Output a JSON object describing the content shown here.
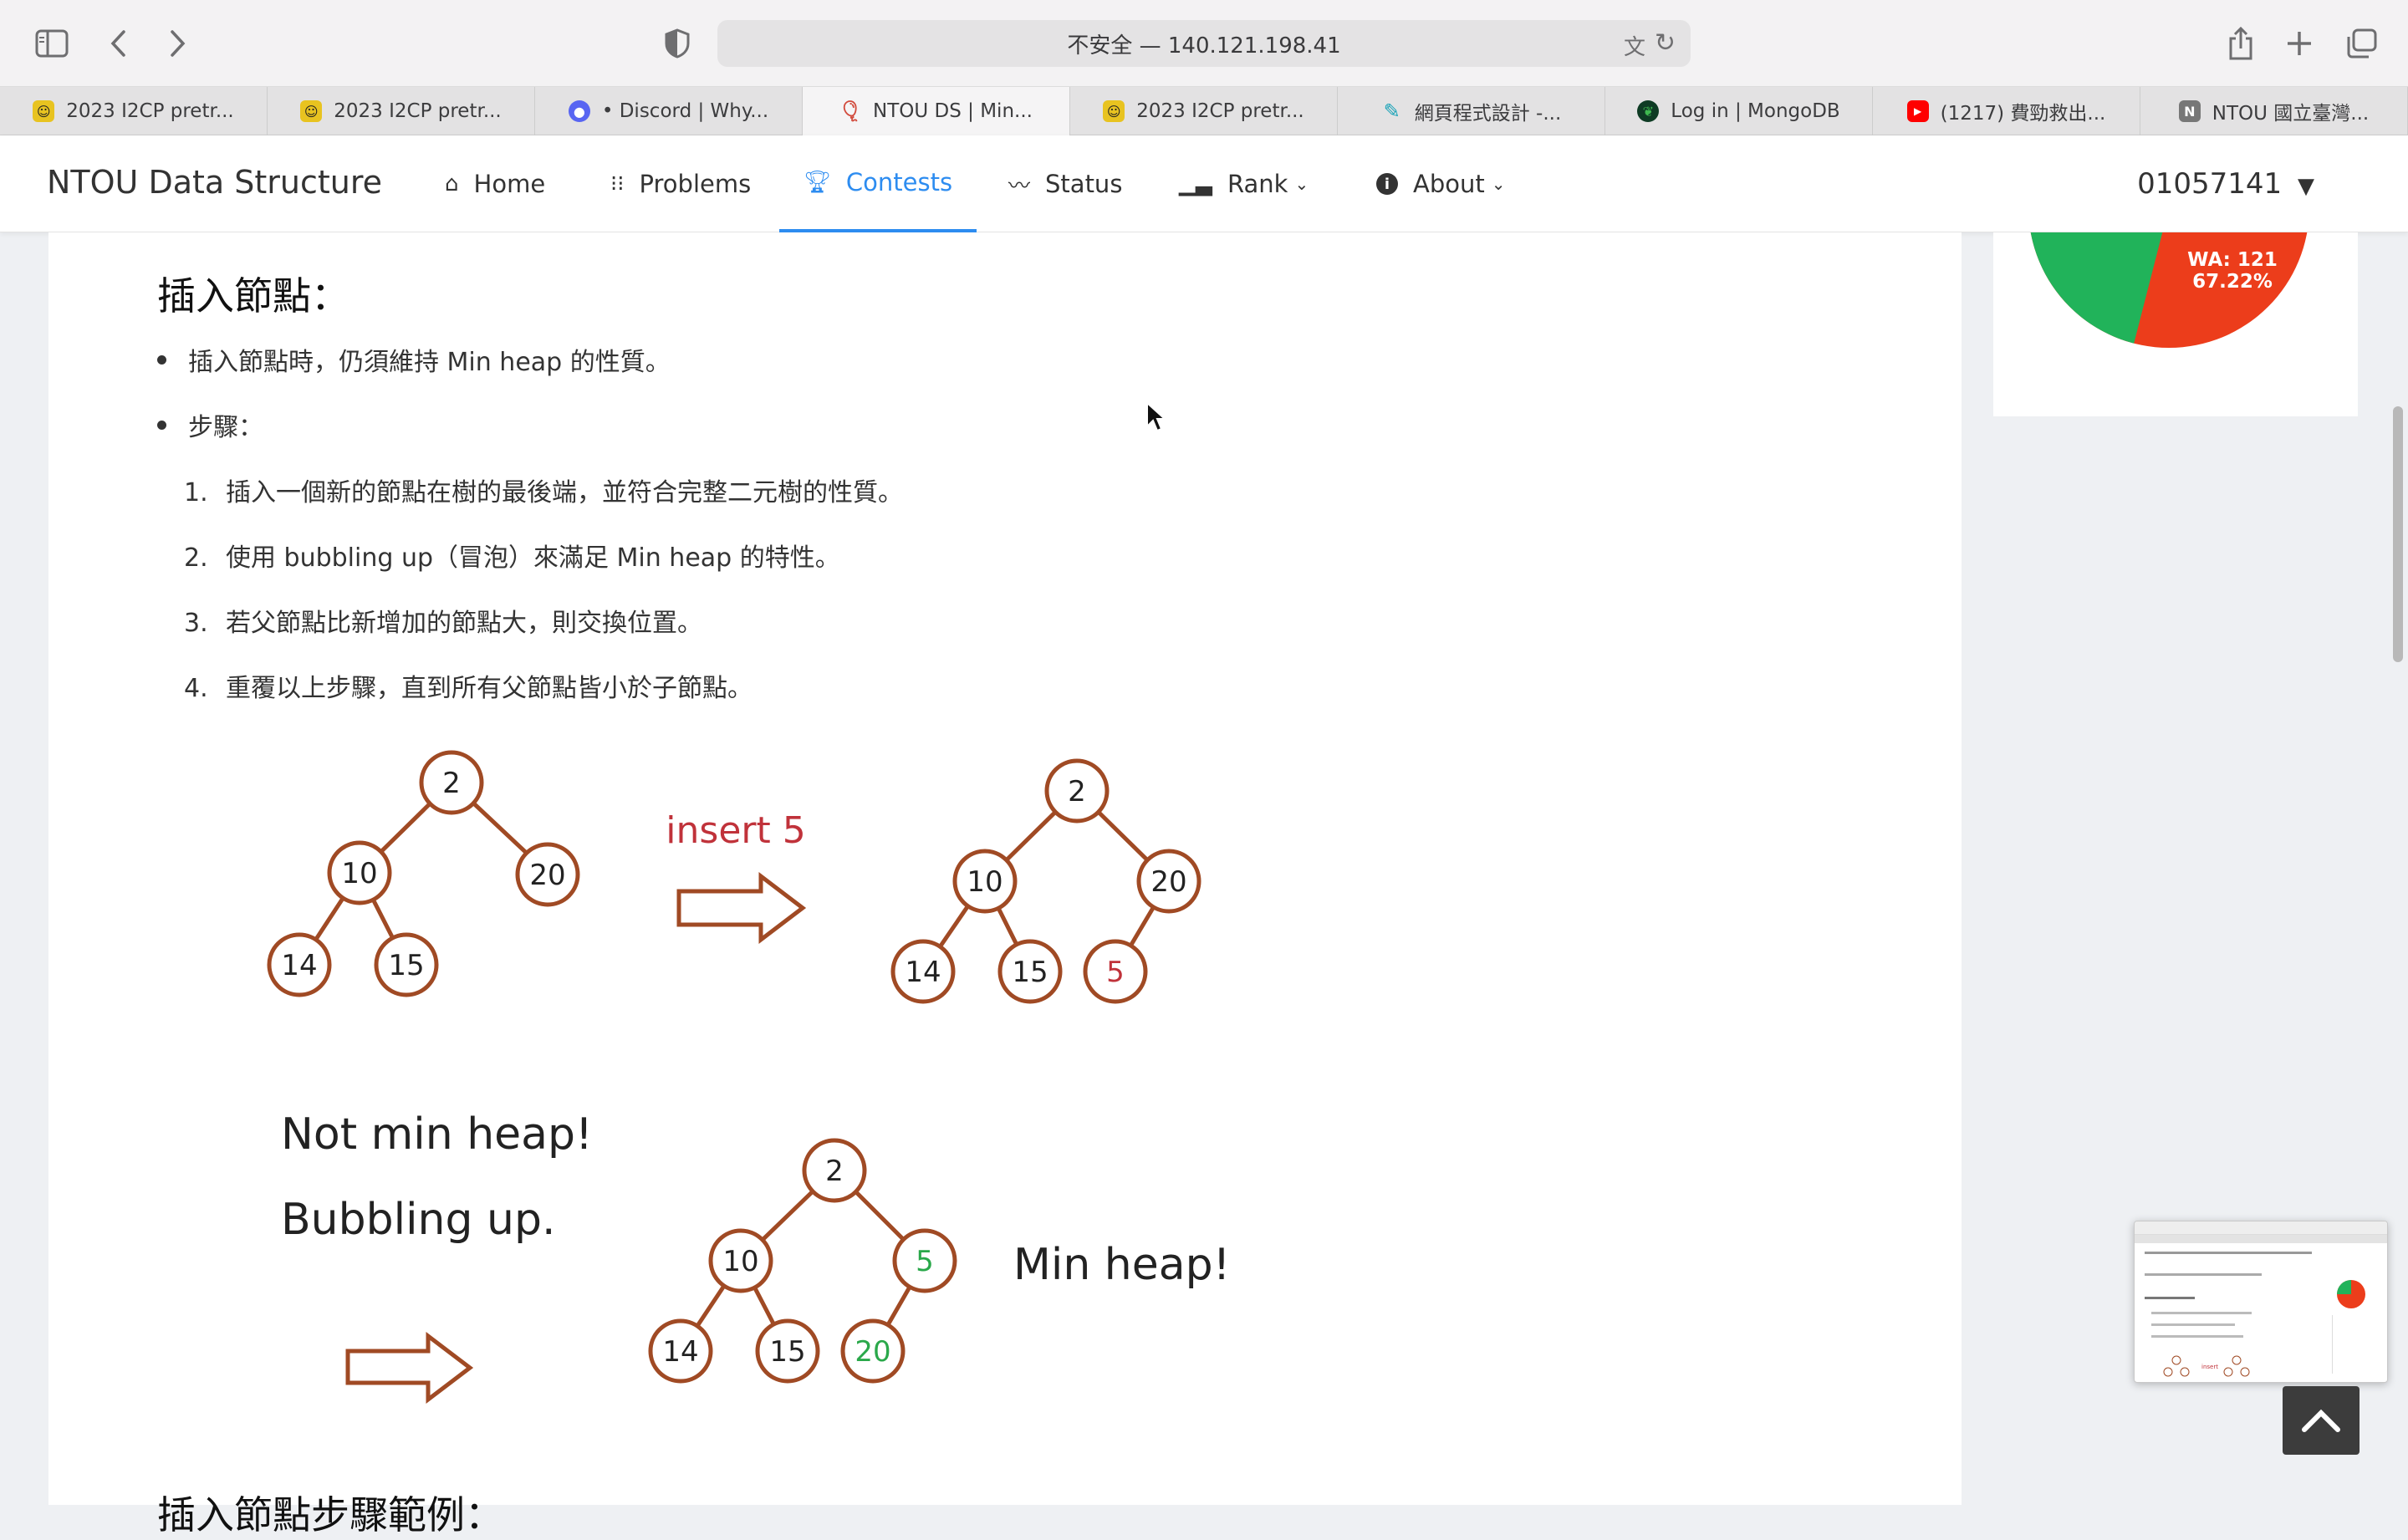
{
  "browser": {
    "url_text": "不安全 — 140.121.198.41",
    "tabs": [
      {
        "label": "2023 I2CP pretr...",
        "icon": "smiley-icon",
        "color": "#e8c320"
      },
      {
        "label": "2023 I2CP pretr...",
        "icon": "smiley-icon",
        "color": "#e8c320"
      },
      {
        "label": "• Discord | Why...",
        "icon": "discord-icon",
        "color": "#5865f2"
      },
      {
        "label": "NTOU DS | Min...",
        "icon": "balloon-icon",
        "color": "#d24a3c"
      },
      {
        "label": "2023 I2CP pretr...",
        "icon": "smiley-icon",
        "color": "#e8c320"
      },
      {
        "label": "網頁程式設計 -...",
        "icon": "brush-icon",
        "color": "#1aa3b8"
      },
      {
        "label": "Log in | MongoDB",
        "icon": "mongodb-leaf-icon",
        "color": "#0e6b3a"
      },
      {
        "label": "(1217) 費勁救出...",
        "icon": "youtube-icon",
        "color": "#ff0000"
      },
      {
        "label": "NTOU 國立臺灣...",
        "icon": "notion-icon",
        "color": "#777777"
      }
    ]
  },
  "navbar": {
    "brand": "NTOU Data Structure",
    "items": [
      {
        "label": "Home",
        "icon": "home-icon"
      },
      {
        "label": "Problems",
        "icon": "grid-icon"
      },
      {
        "label": "Contests",
        "icon": "trophy-icon"
      },
      {
        "label": "Status",
        "icon": "pulse-icon"
      },
      {
        "label": "Rank",
        "icon": "bar-chart-icon"
      },
      {
        "label": "About",
        "icon": "info-icon"
      }
    ],
    "active": "Contests",
    "user": "01057141"
  },
  "content": {
    "section_title": "插入節點：",
    "bullet1": "插入節點時，仍須維持 Min heap 的性質。",
    "bullet2": "步驟：",
    "steps": [
      {
        "num": "1.",
        "text": "插入一個新的節點在樹的最後端，並符合完整二元樹的性質。"
      },
      {
        "num": "2.",
        "text": "使用 bubbling up（冒泡）來滿足 Min heap 的特性。"
      },
      {
        "num": "3.",
        "text": "若父節點比新增加的節點大，則交換位置。"
      },
      {
        "num": "4.",
        "text": "重覆以上步驟，直到所有父節點皆小於子節點。"
      }
    ],
    "next_title": "插入節點步驟範例：",
    "figure1": {
      "left_tree": [
        "2",
        "10",
        "20",
        "14",
        "15"
      ],
      "arrow_label": "insert 5",
      "right_tree": [
        "2",
        "10",
        "20",
        "14",
        "15",
        "5"
      ]
    },
    "figure2": {
      "text1": "Not min heap!",
      "text2": "Bubbling up.",
      "tree": [
        "2",
        "10",
        "5",
        "14",
        "15",
        "20"
      ],
      "result": "Min heap!"
    }
  },
  "sidebar": {
    "pie_label": "WA: 121",
    "pie_percent": "67.22%",
    "wa_fraction": 0.6722,
    "colors": {
      "wa": "#ec3d1b",
      "ac": "#21b35a"
    }
  },
  "colors": {
    "accent": "#2d8cf0",
    "node_stroke": "#a04a24",
    "red_text": "#c0323a",
    "green_text": "#2aa84a"
  }
}
